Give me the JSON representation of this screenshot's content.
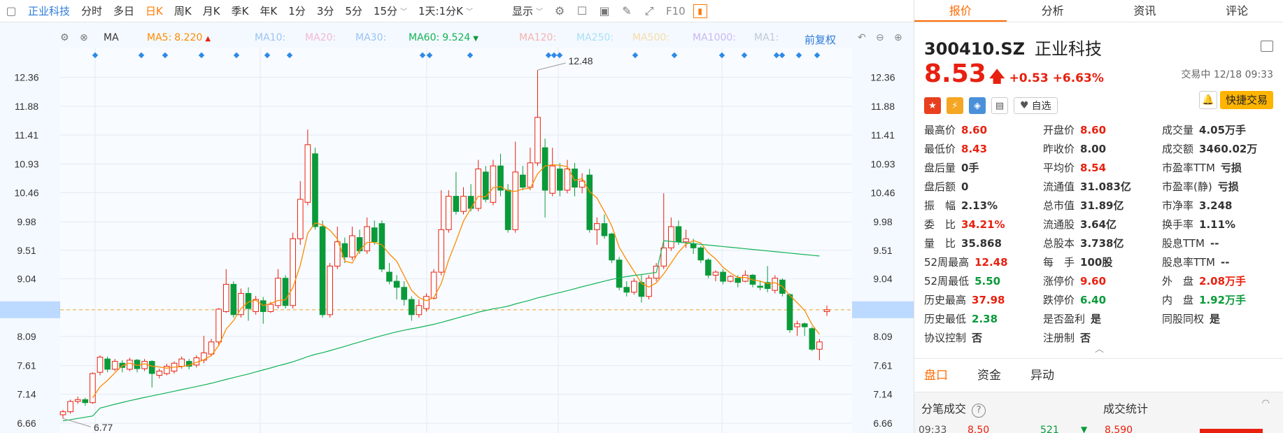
{
  "toolbar": {
    "stock_name": "正业科技",
    "periods": [
      "分时",
      "多日",
      "日K",
      "周K",
      "月K",
      "季K",
      "年K",
      "1分",
      "3分",
      "5分",
      "15分"
    ],
    "active_period": "日K",
    "range_select": "1天:1分K",
    "display_label": "显示",
    "f10_label": "F10"
  },
  "ma_bar": {
    "label": "MA",
    "items": [
      {
        "name": "MA5",
        "value": "8.220",
        "arrow": "▲",
        "color": "#ff8a00"
      },
      {
        "name": "MA10",
        "value": "",
        "color": "#9bc4f2"
      },
      {
        "name": "MA20",
        "value": "",
        "color": "#f2b8d6"
      },
      {
        "name": "MA30",
        "value": "",
        "color": "#9bc4f2"
      },
      {
        "name": "MA60",
        "value": "9.524",
        "arrow": "▼",
        "color": "#12b357"
      },
      {
        "name": "MA120",
        "value": "",
        "color": "#f5b2b2"
      },
      {
        "name": "MA250",
        "value": "",
        "color": "#a8e0f5"
      },
      {
        "name": "MA500",
        "value": "",
        "color": "#f5dca8"
      },
      {
        "name": "MA1000",
        "value": "",
        "color": "#c8b8f0"
      },
      {
        "name": "MA1",
        "value": "",
        "color": "#c0c8d8"
      }
    ],
    "adjust_label": "前复权"
  },
  "chart_data": {
    "type": "candlestick",
    "y_ticks": [
      "12.36",
      "11.88",
      "11.41",
      "10.93",
      "10.46",
      "9.98",
      "9.51",
      "9.04",
      "8.53",
      "8.09",
      "7.61",
      "7.14",
      "6.66"
    ],
    "current_price_label": "8.53",
    "ylim": [
      6.5,
      12.85
    ],
    "high_annotation": "12.48",
    "low_annotation": "6.77",
    "candles": [
      [
        6.8,
        6.85,
        6.74,
        6.88
      ],
      [
        6.85,
        7.02,
        6.82,
        7.05
      ],
      [
        7.02,
        7.05,
        6.98,
        7.1
      ],
      [
        7.05,
        7.0,
        6.95,
        7.08
      ],
      [
        7.0,
        7.48,
        6.98,
        7.5
      ],
      [
        7.5,
        7.75,
        7.45,
        7.78
      ],
      [
        7.72,
        7.55,
        7.5,
        7.76
      ],
      [
        7.55,
        7.68,
        7.52,
        7.72
      ],
      [
        7.65,
        7.58,
        7.5,
        7.7
      ],
      [
        7.55,
        7.7,
        7.52,
        7.74
      ],
      [
        7.7,
        7.56,
        7.5,
        7.72
      ],
      [
        7.56,
        7.68,
        7.52,
        7.72
      ],
      [
        7.68,
        7.48,
        7.25,
        7.7
      ],
      [
        7.45,
        7.52,
        7.4,
        7.56
      ],
      [
        7.48,
        7.6,
        7.45,
        7.64
      ],
      [
        7.52,
        7.65,
        7.48,
        7.68
      ],
      [
        7.6,
        7.72,
        7.56,
        7.76
      ],
      [
        7.68,
        7.6,
        7.55,
        7.72
      ],
      [
        7.62,
        7.74,
        7.58,
        7.78
      ],
      [
        7.7,
        7.82,
        7.65,
        8.1
      ],
      [
        7.8,
        8.0,
        7.76,
        8.05
      ],
      [
        8.0,
        8.54,
        7.95,
        8.56
      ],
      [
        8.5,
        8.95,
        8.48,
        9.2
      ],
      [
        8.95,
        8.45,
        8.4,
        9.0
      ],
      [
        8.45,
        8.8,
        8.4,
        8.88
      ],
      [
        8.8,
        8.55,
        8.35,
        8.9
      ],
      [
        8.5,
        8.7,
        8.45,
        8.76
      ],
      [
        8.68,
        8.5,
        8.3,
        8.74
      ],
      [
        8.5,
        8.62,
        8.48,
        8.66
      ],
      [
        8.6,
        9.05,
        8.55,
        9.2
      ],
      [
        9.05,
        8.6,
        8.55,
        9.1
      ],
      [
        8.6,
        9.7,
        8.55,
        9.8
      ],
      [
        9.7,
        10.35,
        9.6,
        10.65
      ],
      [
        10.3,
        11.25,
        10.25,
        11.5
      ],
      [
        11.1,
        9.9,
        9.85,
        11.2
      ],
      [
        9.9,
        8.45,
        8.4,
        10.0
      ],
      [
        8.45,
        9.25,
        8.4,
        9.3
      ],
      [
        9.25,
        9.65,
        9.2,
        9.9
      ],
      [
        9.62,
        9.4,
        9.3,
        9.72
      ],
      [
        9.4,
        9.75,
        9.35,
        9.9
      ],
      [
        9.72,
        9.5,
        9.45,
        9.85
      ],
      [
        9.5,
        9.9,
        9.45,
        10.05
      ],
      [
        9.88,
        9.65,
        9.6,
        10.0
      ],
      [
        9.95,
        9.2,
        9.15,
        10.0
      ],
      [
        9.15,
        9.0,
        8.95,
        9.3
      ],
      [
        9.0,
        8.9,
        8.7,
        9.1
      ],
      [
        8.9,
        8.7,
        8.6,
        9.0
      ],
      [
        8.7,
        8.45,
        8.35,
        8.75
      ],
      [
        8.45,
        8.6,
        8.4,
        8.7
      ],
      [
        8.55,
        8.75,
        8.5,
        8.8
      ],
      [
        8.72,
        9.15,
        8.7,
        9.2
      ],
      [
        9.15,
        9.85,
        9.1,
        10.5
      ],
      [
        9.85,
        10.4,
        9.8,
        10.5
      ],
      [
        10.4,
        10.15,
        10.1,
        10.8
      ],
      [
        10.15,
        10.4,
        10.1,
        10.55
      ],
      [
        10.4,
        10.2,
        10.15,
        10.6
      ],
      [
        10.2,
        10.85,
        10.15,
        11.0
      ],
      [
        10.8,
        10.35,
        10.3,
        10.9
      ],
      [
        10.3,
        10.9,
        10.25,
        11.0
      ],
      [
        10.9,
        10.5,
        10.4,
        11.1
      ],
      [
        10.5,
        9.85,
        9.8,
        10.6
      ],
      [
        9.85,
        10.8,
        9.8,
        11.3
      ],
      [
        10.75,
        10.55,
        10.5,
        10.9
      ],
      [
        10.55,
        10.95,
        10.5,
        11.2
      ],
      [
        10.95,
        11.7,
        10.9,
        12.48
      ],
      [
        11.2,
        10.5,
        10.05,
        11.35
      ],
      [
        10.45,
        10.9,
        10.4,
        11.2
      ],
      [
        10.85,
        10.5,
        10.4,
        10.95
      ],
      [
        10.5,
        10.85,
        10.45,
        11.0
      ],
      [
        10.85,
        10.55,
        10.4,
        10.95
      ],
      [
        10.55,
        10.65,
        10.45,
        10.78
      ],
      [
        10.75,
        9.85,
        9.8,
        10.85
      ],
      [
        9.85,
        9.95,
        9.6,
        10.05
      ],
      [
        9.95,
        9.75,
        9.7,
        10.1
      ],
      [
        9.78,
        9.35,
        9.3,
        9.8
      ],
      [
        9.35,
        8.9,
        8.85,
        9.4
      ],
      [
        8.9,
        8.82,
        8.75,
        9.0
      ],
      [
        8.82,
        9.0,
        8.78,
        9.05
      ],
      [
        8.98,
        8.75,
        8.65,
        9.1
      ],
      [
        8.75,
        9.05,
        8.7,
        9.1
      ],
      [
        9.05,
        9.25,
        9.0,
        9.3
      ],
      [
        9.25,
        9.55,
        9.2,
        10.45
      ],
      [
        9.55,
        9.9,
        9.5,
        10.05
      ],
      [
        9.9,
        9.65,
        9.6,
        10.0
      ],
      [
        9.65,
        9.7,
        9.55,
        9.85
      ],
      [
        9.62,
        9.55,
        9.45,
        9.7
      ],
      [
        9.55,
        9.35,
        9.3,
        9.58
      ],
      [
        9.35,
        9.1,
        9.05,
        9.38
      ],
      [
        9.1,
        9.15,
        9.0,
        9.18
      ],
      [
        9.15,
        9.0,
        8.95,
        9.2
      ],
      [
        9.0,
        9.08,
        8.98,
        9.1
      ],
      [
        9.05,
        8.98,
        8.9,
        9.1
      ],
      [
        9.0,
        9.1,
        8.98,
        9.18
      ],
      [
        9.1,
        8.95,
        8.9,
        9.12
      ],
      [
        8.92,
        8.9,
        8.85,
        9.0
      ],
      [
        8.98,
        8.88,
        8.82,
        9.25
      ],
      [
        8.85,
        9.05,
        8.8,
        9.1
      ],
      [
        9.02,
        8.8,
        8.75,
        9.05
      ],
      [
        8.78,
        8.2,
        8.15,
        8.8
      ],
      [
        8.25,
        8.3,
        8.1,
        8.35
      ],
      [
        8.3,
        8.25,
        8.1,
        8.32
      ],
      [
        8.22,
        7.88,
        7.85,
        8.25
      ],
      [
        7.88,
        8.0,
        7.7,
        8.05
      ],
      [
        8.5,
        8.53,
        8.43,
        8.6
      ]
    ]
  },
  "panel": {
    "tabs": [
      "报价",
      "分析",
      "资讯",
      "评论"
    ],
    "active_tab": "报价",
    "code": "300410.SZ",
    "name": "正业科技",
    "price": "8.53",
    "change": "+0.53",
    "change_pct": "+6.63%",
    "status": "交易中 12/18 09:33",
    "watch_label": "自选",
    "trade_label": "快捷交易",
    "quote_rows": [
      [
        {
          "label": "最高价",
          "value": "8.60",
          "c": "red"
        },
        {
          "label": "开盘价",
          "value": "8.60",
          "c": "red"
        },
        {
          "label": "成交量",
          "value": "4.05万手",
          "c": "dark"
        }
      ],
      [
        {
          "label": "最低价",
          "value": "8.43",
          "c": "red"
        },
        {
          "label": "昨收价",
          "value": "8.00",
          "c": "dark"
        },
        {
          "label": "成交额",
          "value": "3460.02万",
          "c": "dark"
        }
      ],
      [
        {
          "label": "盘后量",
          "value": "0手",
          "c": "dark"
        },
        {
          "label": "平均价",
          "value": "8.54",
          "c": "red"
        },
        {
          "label": "市盈率TTM",
          "value": "亏损",
          "c": "dark"
        }
      ],
      [
        {
          "label": "盘后额",
          "value": "0",
          "c": "dark"
        },
        {
          "label": "流通值",
          "value": "31.083亿",
          "c": "dark"
        },
        {
          "label": "市盈率(静)",
          "value": "亏损",
          "c": "dark"
        }
      ],
      [
        {
          "label": "振　幅",
          "value": "2.13%",
          "c": "dark"
        },
        {
          "label": "总市值",
          "value": "31.89亿",
          "c": "dark"
        },
        {
          "label": "市净率",
          "value": "3.248",
          "c": "dark"
        }
      ],
      [
        {
          "label": "委　比",
          "value": "34.21%",
          "c": "red"
        },
        {
          "label": "流通股",
          "value": "3.64亿",
          "c": "dark"
        },
        {
          "label": "换手率",
          "value": "1.11%",
          "c": "dark"
        }
      ],
      [
        {
          "label": "量　比",
          "value": "35.868",
          "c": "dark"
        },
        {
          "label": "总股本",
          "value": "3.738亿",
          "c": "dark"
        },
        {
          "label": "股息TTM",
          "value": "--",
          "c": "dark"
        }
      ],
      [
        {
          "label": "52周最高",
          "value": "12.48",
          "c": "red"
        },
        {
          "label": "每　手",
          "value": "100股",
          "c": "dark"
        },
        {
          "label": "股息率TTM",
          "value": "--",
          "c": "dark"
        }
      ],
      [
        {
          "label": "52周最低",
          "value": "5.50",
          "c": "green"
        },
        {
          "label": "涨停价",
          "value": "9.60",
          "c": "red"
        },
        {
          "label": "外　盘",
          "value": "2.08万手",
          "c": "red"
        }
      ],
      [
        {
          "label": "历史最高",
          "value": "37.98",
          "c": "red"
        },
        {
          "label": "跌停价",
          "value": "6.40",
          "c": "green"
        },
        {
          "label": "内　盘",
          "value": "1.92万手",
          "c": "green"
        }
      ],
      [
        {
          "label": "历史最低",
          "value": "2.38",
          "c": "green"
        },
        {
          "label": "是否盈利",
          "value": "是",
          "c": "dark"
        },
        {
          "label": "同股同权",
          "value": "是",
          "c": "dark"
        }
      ],
      [
        {
          "label": "协议控制",
          "value": "否",
          "c": "dark"
        },
        {
          "label": "注册制",
          "value": "否",
          "c": "dark"
        },
        {
          "label": "",
          "value": "",
          "c": "dark"
        }
      ]
    ],
    "bottom_tabs": [
      "盘口",
      "资金",
      "异动"
    ],
    "active_bottom": "盘口",
    "tick_title": "分笔成交",
    "stats_title": "成交统计",
    "tick_row": {
      "time": "09:33",
      "price": "8.50",
      "vol": "521"
    },
    "stats_value": "8.590"
  },
  "colors": {
    "up": "#e8200f",
    "down": "#0a9a3a",
    "accent": "#ff6a00",
    "blue": "#2e7bd9"
  }
}
